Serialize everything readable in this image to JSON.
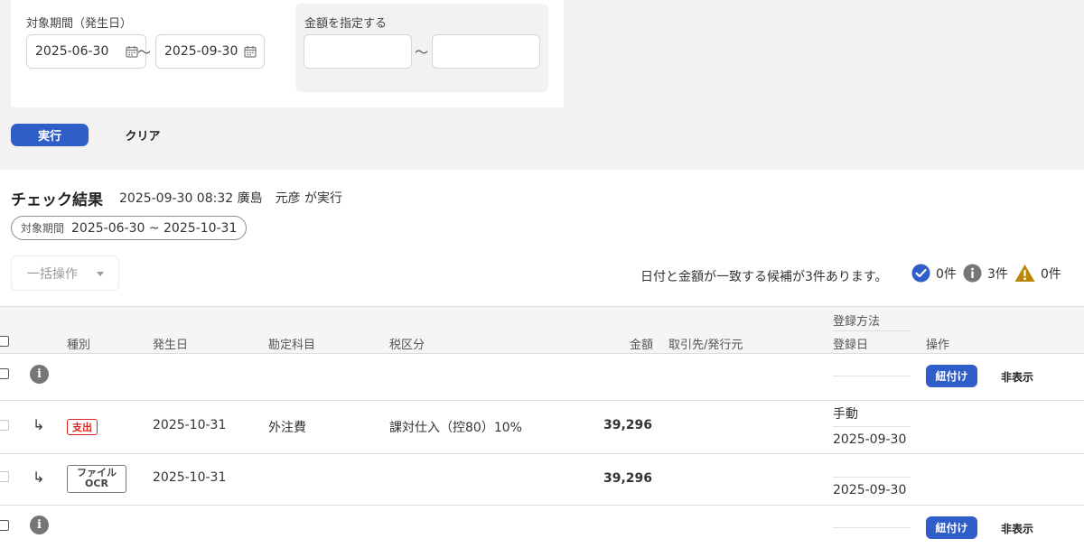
{
  "filters": {
    "period_label": "対象期間（発生日）",
    "date_from": "2025-06-30",
    "date_to": "2025-09-30",
    "tilde": "〜",
    "amount_label": "金額を指定する",
    "amount_from": "",
    "amount_to": ""
  },
  "actions": {
    "run_label": "実行",
    "clear_label": "クリア"
  },
  "results": {
    "title": "チェック結果",
    "meta": "2025-09-30 08:32 廣島　元彦 が実行",
    "period_key": "対象期間",
    "period_value": "2025-06-30 ~ 2025-10-31",
    "bulk_label": "一括操作",
    "summary_text": "日付と金額が一致する候補が3件あります。",
    "stats": [
      {
        "icon": "check-circle-icon",
        "count": "0件",
        "color": "#2f5ec9"
      },
      {
        "icon": "info-circle-icon",
        "count": "3件",
        "color": "#767676"
      },
      {
        "icon": "warning-triangle-icon",
        "count": "0件",
        "color": "#b8860b"
      }
    ]
  },
  "table": {
    "headers": {
      "type": "種別",
      "date": "発生日",
      "account": "勘定科目",
      "tax": "税区分",
      "amount": "金額",
      "partner": "取引先/発行元",
      "reg_method": "登録方法",
      "reg_date": "登録日",
      "ops": "操作"
    },
    "rows": [
      {
        "kind": "group",
        "link_label": "紐付け",
        "hide_label": "非表示"
      },
      {
        "kind": "child",
        "type_badge": "支出",
        "date": "2025-10-31",
        "account": "外注費",
        "tax": "課対仕入（控80）10%",
        "amount": "39,296",
        "reg_method": "手動",
        "reg_date": "2025-09-30"
      },
      {
        "kind": "child",
        "type_badge_line1": "ファイル",
        "type_badge_line2": "OCR",
        "date": "2025-10-31",
        "amount": "39,296",
        "reg_method": "",
        "reg_date": "2025-09-30"
      },
      {
        "kind": "group",
        "link_label": "紐付け",
        "hide_label": "非表示"
      }
    ],
    "child_arrow": "↳"
  }
}
